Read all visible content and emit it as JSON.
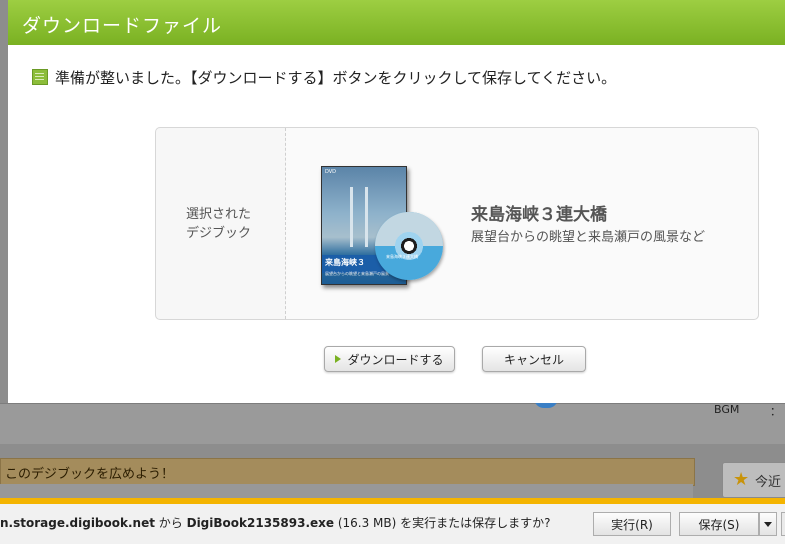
{
  "background": {
    "bgm_label": "BGM",
    "bgm_sep": "：",
    "share_banner": "このデジブックを広めよう！",
    "right_button": "今近"
  },
  "dialog": {
    "title": "ダウンロードファイル",
    "message": "準備が整いました。【ダウンロードする】ボタンをクリックして保存してください。",
    "selected_label_line1": "選択された",
    "selected_label_line2": "デジブック",
    "book": {
      "title": "来島海峡３連大橋",
      "description": "展望台からの眺望と来島瀬戸の風景など",
      "cover_title": "来島海峡３",
      "cover_sub": "展望台からの眺望と来島瀬戸の風景",
      "cover_dvd": "DVD",
      "disc_text": "来島海峡３連大橋"
    },
    "download_button": "ダウンロードする",
    "cancel_button": "キャンセル"
  },
  "download_bar": {
    "host": "n.storage.digibook.net",
    "from": " から ",
    "filename": "DigiBook2135893.exe",
    "size": " (16.3 MB) ",
    "question": "を実行または保存しますか?",
    "run_button": "実行(R)",
    "save_button": "保存(S)"
  },
  "colors": {
    "header_green": "#8cc43a",
    "accent_bar": "#f4b400"
  }
}
